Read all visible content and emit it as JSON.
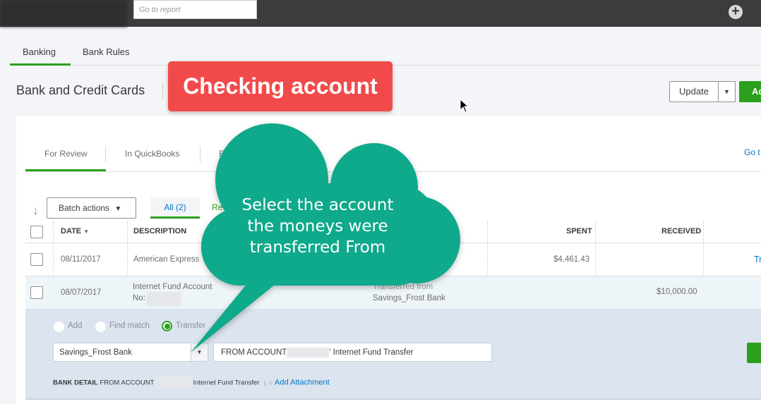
{
  "topbar": {
    "search_placeholder": "Go to report",
    "plus_icon": "plus-circle-icon"
  },
  "nav_tabs": [
    "Banking",
    "Bank Rules"
  ],
  "page_title": "Bank and Credit Cards",
  "annotation_label": "Checking account",
  "annotation_callout": [
    "Select the account",
    "the moneys were",
    "transferred From"
  ],
  "header_buttons": {
    "update": "Update",
    "add": "Ad"
  },
  "review_tabs": [
    "For Review",
    "In QuickBooks",
    "Exclu"
  ],
  "go_to_link": "Go t",
  "toolbar": {
    "batch_actions": "Batch actions",
    "all_chip": "All (2)",
    "recognized": "Re"
  },
  "table": {
    "columns": {
      "date": "DATE",
      "description": "DESCRIPTION",
      "spent": "SPENT",
      "received": "RECEIVED"
    },
    "rows": [
      {
        "date": "08/11/2017",
        "description": "American Express",
        "payee": "",
        "spent": "$4,461.43",
        "received": "",
        "action": "Tr"
      },
      {
        "date": "08/07/2017",
        "description": "Internet Fund Account",
        "description2": "No:",
        "category1": "Transferred from",
        "category2": "Savings_Frost Bank",
        "spent": "",
        "received": "$10,000.00"
      }
    ]
  },
  "detail": {
    "options": [
      "Add",
      "Find match",
      "Transfer"
    ],
    "selected_option": "Transfer",
    "account": "Savings_Frost Bank",
    "memo_prefix": "FROM ACCOUNT",
    "memo_suffix": "' Internet Fund Transfer",
    "bank_detail_label": "BANK DETAIL",
    "bank_detail_prefix": "FROM ACCOUNT",
    "bank_detail_suffix": "Internet Fund Transfer",
    "add_attachment": "Add Attachment"
  },
  "colors": {
    "green": "#2ca01c",
    "annotation_red": "#f24a4a",
    "callout_teal": "#0fa98b",
    "link": "#0077c5"
  }
}
